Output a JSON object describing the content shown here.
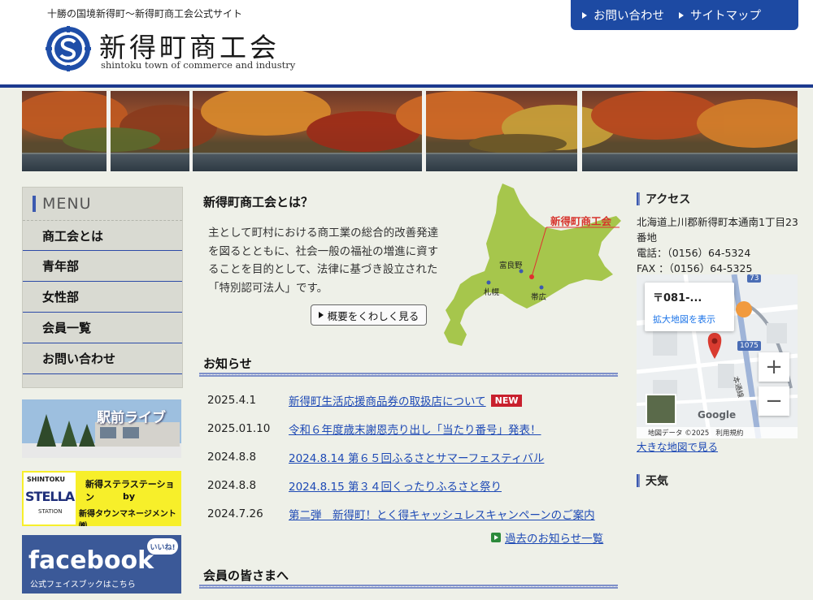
{
  "header": {
    "tagline": "十勝の国境新得町～新得町商工会公式サイト",
    "title": "新得町商工会",
    "subtitle": "shintoku town of commerce and industry",
    "nav": [
      {
        "label": "お問い合わせ"
      },
      {
        "label": "サイトマップ"
      }
    ]
  },
  "menu": {
    "heading": "MENU",
    "items": [
      {
        "label": "商工会とは"
      },
      {
        "label": "青年部"
      },
      {
        "label": "女性部"
      },
      {
        "label": "会員一覧"
      },
      {
        "label": "お問い合わせ"
      }
    ]
  },
  "side_banners": {
    "ekimae": "駅前ライブ",
    "stella_top": "SHINTOKU",
    "stella_logo": "STELLA",
    "stella_sub": "STATION",
    "stella_line1": "新得ステラステーション",
    "stella_line2": "by",
    "stella_line3": "新得タウンマネージメント㈱",
    "fb_main": "facebook",
    "fb_sub": "公式フェイスブックはこちら",
    "fb_badge": "いいね!"
  },
  "about": {
    "title": "新得町商工会とは？",
    "text": "主として町村における商工業の総合的改善発達を図るとともに、社会一般の福祉の増進に資することを目的として、法律に基づき設立された「特別認可法人」です。",
    "button": "概要をくわしく見る",
    "map_labels": {
      "marker": "新得町商工会",
      "furano": "富良野",
      "sapporo": "札幌",
      "obihiro": "帯広"
    }
  },
  "news": {
    "title": "お知らせ",
    "items": [
      {
        "date": "2025.4.1",
        "title": "新得町生活応援商品券の取扱店について",
        "badge": "NEW"
      },
      {
        "date": "2025.01.10",
        "title": "令和６年度歳末謝恩売り出し「当たり番号」発表！",
        "badge": ""
      },
      {
        "date": "2024.8.8",
        "title": "2024.8.14 第６５回ふるさとサマーフェスティバル",
        "badge": ""
      },
      {
        "date": "2024.8.8",
        "title": "2024.8.15 第３４回くったりふるさと祭り",
        "badge": ""
      },
      {
        "date": "2024.7.26",
        "title": "第二弾　新得町！とく得キャッシュレスキャンペーンのご案内",
        "badge": ""
      }
    ],
    "past": "過去のお知らせ一覧"
  },
  "members": {
    "title": "会員の皆さまへ"
  },
  "access": {
    "title": "アクセス",
    "address": "北海道上川郡新得町本通南1丁目23番地",
    "tel": "電話：（0156）64-5324",
    "fax": "FAX ：（0156）64-5325",
    "map_card_title": "〒081-...",
    "map_card_link": "拡大地図を表示",
    "map_road": "1075",
    "map_road2": "73",
    "map_street": "本通線",
    "google": "Google",
    "map_credit": "地図データ ©2025",
    "map_terms": "利用規約",
    "zoom_in": "+",
    "zoom_out": "−",
    "big_map": "大きな地図で見る"
  },
  "weather": {
    "title": "天気"
  },
  "colors": {
    "brand_blue": "#1d4aa3",
    "link": "#1d49b5",
    "new_badge": "#c8202d",
    "hokkaido_green": "#a6c64c"
  }
}
